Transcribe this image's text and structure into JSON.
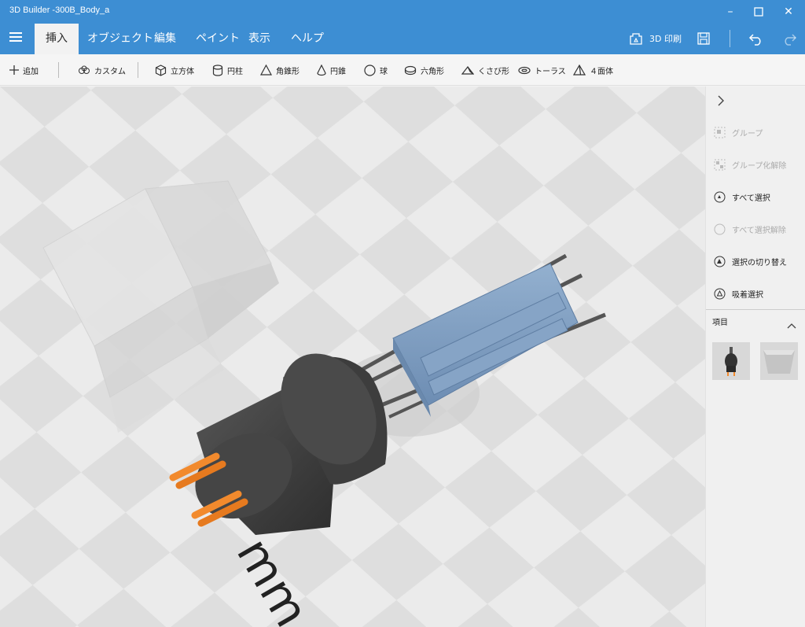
{
  "window": {
    "title": "3D Builder -300B_Body_a",
    "minimize": "–",
    "maximize": "☐",
    "close": "✕"
  },
  "ribbon": {
    "tabs": [
      "挿入",
      "オブジェクト",
      "編集",
      "ペイント",
      "表示",
      "ヘルプ"
    ],
    "active_tab": "挿入",
    "print_label": "3D 印刷"
  },
  "toolbar": {
    "add": "追加",
    "custom": "カスタム",
    "shapes": [
      "立方体",
      "円柱",
      "角錐形",
      "円錐",
      "球",
      "六角形",
      "くさび形",
      "トーラス",
      "４面体"
    ]
  },
  "panel": {
    "actions": [
      {
        "label": "グループ",
        "enabled": false
      },
      {
        "label": "グループ化解除",
        "enabled": false
      },
      {
        "label": "すべて選択",
        "enabled": true
      },
      {
        "label": "すべて選択解除",
        "enabled": false
      },
      {
        "label": "選択の切り替え",
        "enabled": true
      },
      {
        "label": "吸着選択",
        "enabled": true
      }
    ],
    "items_header": "項目"
  },
  "viewport": {
    "floor_label": "mm"
  },
  "colors": {
    "accent": "#3d8ed3",
    "orange_pins": "#f28a2d",
    "blue_parts": "#7c9cc0",
    "dark_base": "#3a3a3a"
  }
}
